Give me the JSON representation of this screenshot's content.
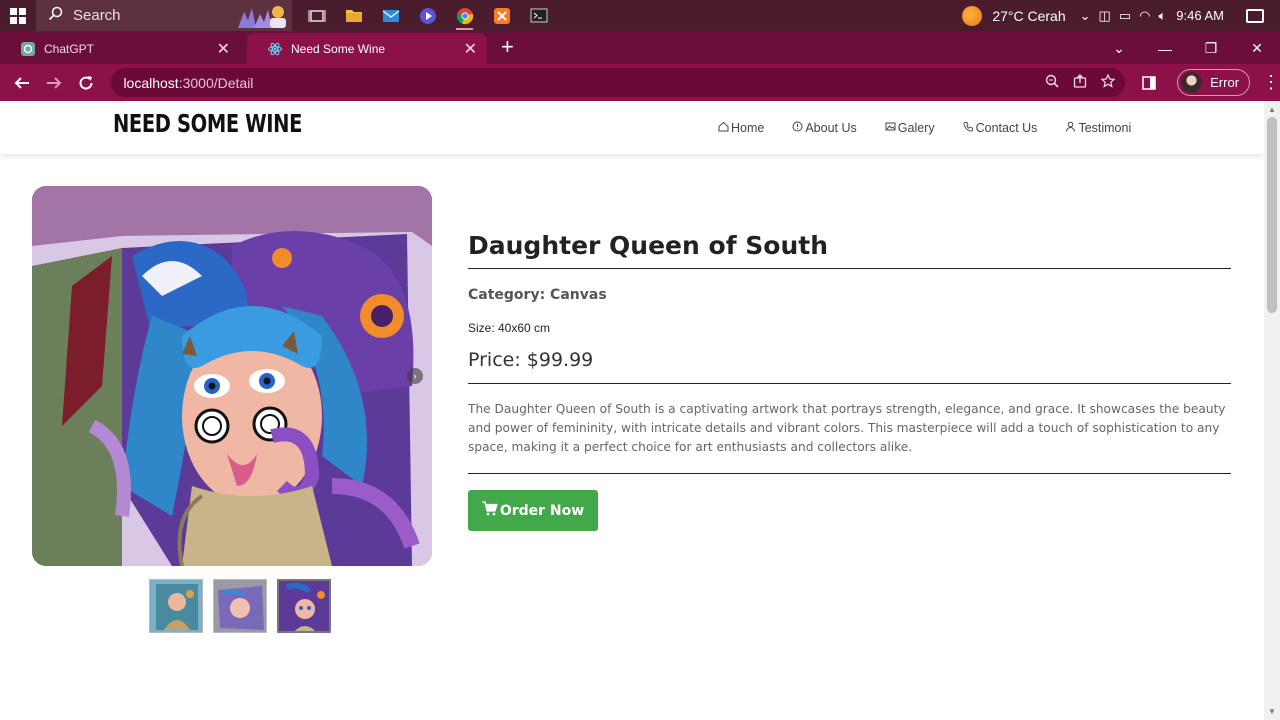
{
  "taskbar": {
    "search_placeholder": "Search",
    "weather": "27°C",
    "weather_desc": "Cerah",
    "time": "9:46 AM"
  },
  "browser": {
    "tabs": [
      {
        "title": "ChatGPT",
        "active": false
      },
      {
        "title": "Need Some Wine",
        "active": true
      }
    ],
    "url_host": "localhost",
    "url_path": ":3000/Detail",
    "profile_label": "Error"
  },
  "site": {
    "brand": "NEED SOME WINE",
    "nav": [
      {
        "label": "Home",
        "icon": "home-icon"
      },
      {
        "label": "About Us",
        "icon": "info-icon"
      },
      {
        "label": "Galery",
        "icon": "image-icon"
      },
      {
        "label": "Contact Us",
        "icon": "phone-icon"
      },
      {
        "label": "Testimoni",
        "icon": "user-icon"
      }
    ]
  },
  "product": {
    "title": "Daughter Queen of South",
    "category": "Category: Canvas",
    "size": "Size: 40x60 cm",
    "price": "Price: $99.99",
    "description": "The Daughter Queen of South is a captivating artwork that portrays strength, elegance, and grace. It showcases the beauty and power of femininity, with intricate details and vibrant colors. This masterpiece will add a touch of sophistication to any space, making it a perfect choice for art enthusiasts and collectors alike.",
    "order_label": "Order Now",
    "thumbnail_count": 3,
    "selected_thumbnail": 3
  },
  "colors": {
    "taskbar": "#4a1c2e",
    "tab_strip": "#6b0f3a",
    "toolbar": "#8c1149",
    "order_button": "#43a84a"
  }
}
